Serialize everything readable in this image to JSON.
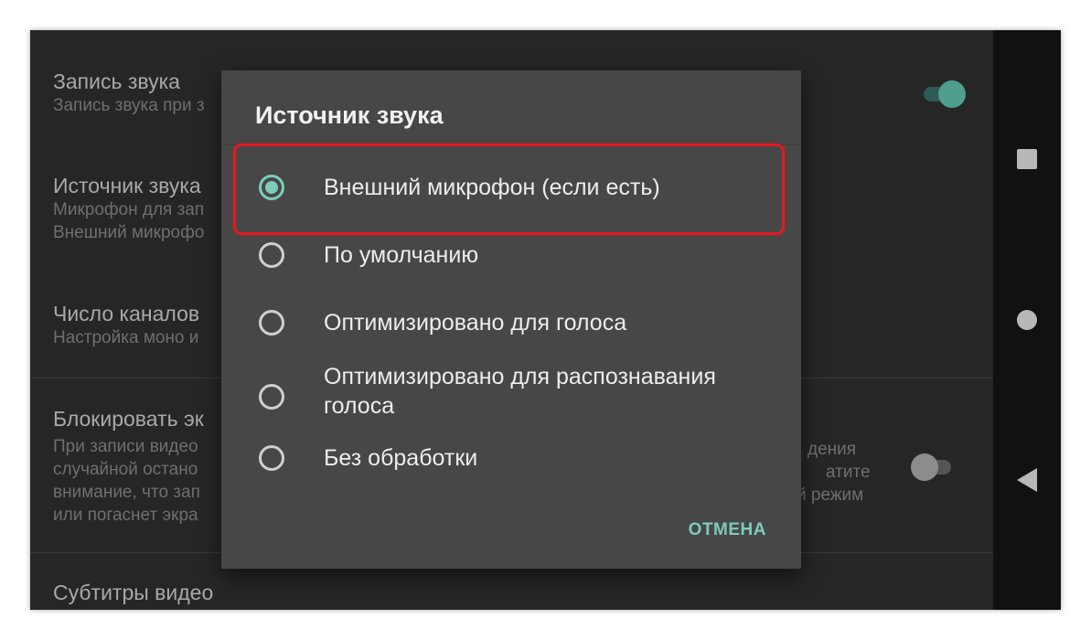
{
  "settings": {
    "items": [
      {
        "title": "Запись звука",
        "subtitle_lines": [
          "Запись звука при з"
        ]
      },
      {
        "title": "Источник звука",
        "subtitle_lines": [
          "Микрофон для зап",
          "Внешний микрофо"
        ]
      },
      {
        "title": "Число каналов",
        "subtitle_lines": [
          "Настройка моно и"
        ]
      },
      {
        "title": "Блокировать эк",
        "subtitle_lines": [
          "При записи видео",
          "случайной остано",
          "внимание, что зап",
          "или погаснет экра"
        ]
      },
      {
        "title": "Субтитры видео",
        "subtitle_lines": []
      }
    ],
    "lock_right_lines": [
      "дения",
      "атите",
      "й режим"
    ],
    "toggles": {
      "audio_recording": "on",
      "lock_screen": "off"
    }
  },
  "dialog": {
    "title": "Источник звука",
    "options": [
      {
        "label": "Внешний микрофон (если есть)",
        "selected": true
      },
      {
        "label": "По умолчанию",
        "selected": false
      },
      {
        "label": "Оптимизировано для голоса",
        "selected": false
      },
      {
        "label": "Оптимизировано для распознавания голоса",
        "selected": false
      },
      {
        "label": "Без обработки",
        "selected": false
      }
    ],
    "cancel_label": "ОТМЕНА"
  },
  "navigation": {
    "buttons": [
      "recents-icon",
      "home-icon",
      "back-icon"
    ]
  },
  "colors": {
    "accent": "#7fcbbb",
    "highlight": "#e01a22",
    "dialog_bg": "#474747",
    "screen_bg": "#262626"
  }
}
